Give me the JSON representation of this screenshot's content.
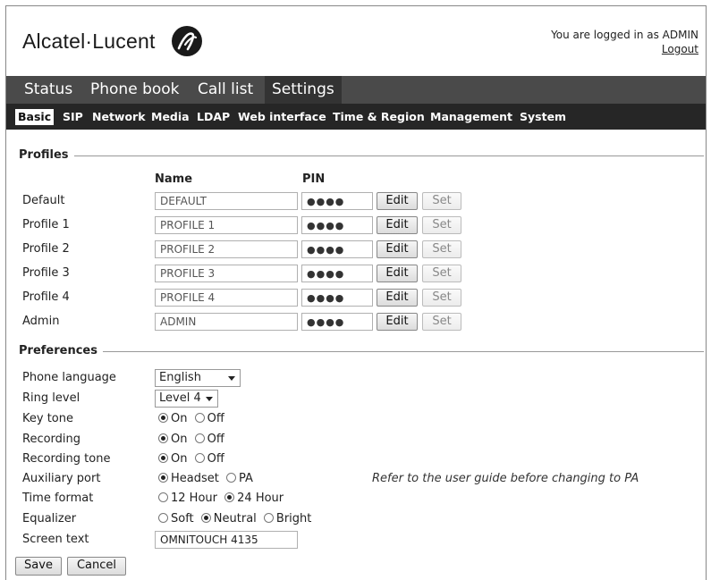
{
  "header": {
    "brand": "Alcatel·Lucent",
    "logged_in_text": "You are logged in as ADMIN",
    "logout_label": "Logout"
  },
  "main_tabs": [
    {
      "label": "Status"
    },
    {
      "label": "Phone book"
    },
    {
      "label": "Call list"
    },
    {
      "label": "Settings",
      "active": true
    }
  ],
  "sub_tabs": [
    {
      "label": "Basic",
      "active": true
    },
    {
      "label": "SIP"
    },
    {
      "label": "Network"
    },
    {
      "label": "Media"
    },
    {
      "label": "LDAP"
    },
    {
      "label": "Web interface"
    },
    {
      "label": "Time & Region"
    },
    {
      "label": "Management"
    },
    {
      "label": "System"
    }
  ],
  "profiles": {
    "title": "Profiles",
    "col_name": "Name",
    "col_pin": "PIN",
    "edit_label": "Edit",
    "set_label": "Set",
    "rows": [
      {
        "label": "Default",
        "name": "DEFAULT",
        "pin": "●●●●"
      },
      {
        "label": "Profile 1",
        "name": "PROFILE 1",
        "pin": "●●●●"
      },
      {
        "label": "Profile 2",
        "name": "PROFILE 2",
        "pin": "●●●●"
      },
      {
        "label": "Profile 3",
        "name": "PROFILE 3",
        "pin": "●●●●"
      },
      {
        "label": "Profile 4",
        "name": "PROFILE 4",
        "pin": "●●●●"
      },
      {
        "label": "Admin",
        "name": "ADMIN",
        "pin": "●●●●"
      }
    ]
  },
  "preferences": {
    "title": "Preferences",
    "phone_language": {
      "label": "Phone language",
      "value": "English"
    },
    "ring_level": {
      "label": "Ring level",
      "value": "Level 4"
    },
    "key_tone": {
      "label": "Key tone",
      "options": [
        "On",
        "Off"
      ],
      "selected": "On"
    },
    "recording": {
      "label": "Recording",
      "options": [
        "On",
        "Off"
      ],
      "selected": "On"
    },
    "recording_tone": {
      "label": "Recording tone",
      "options": [
        "On",
        "Off"
      ],
      "selected": "On"
    },
    "auxiliary_port": {
      "label": "Auxiliary port",
      "options": [
        "Headset",
        "PA"
      ],
      "selected": "Headset",
      "note": "Refer to the user guide before changing to PA"
    },
    "time_format": {
      "label": "Time format",
      "options": [
        "12 Hour",
        "24 Hour"
      ],
      "selected": "24 Hour"
    },
    "equalizer": {
      "label": "Equalizer",
      "options": [
        "Soft",
        "Neutral",
        "Bright"
      ],
      "selected": "Neutral"
    },
    "screen_text": {
      "label": "Screen text",
      "value": "OMNITOUCH 4135"
    }
  },
  "footer": {
    "save_label": "Save",
    "cancel_label": "Cancel"
  }
}
